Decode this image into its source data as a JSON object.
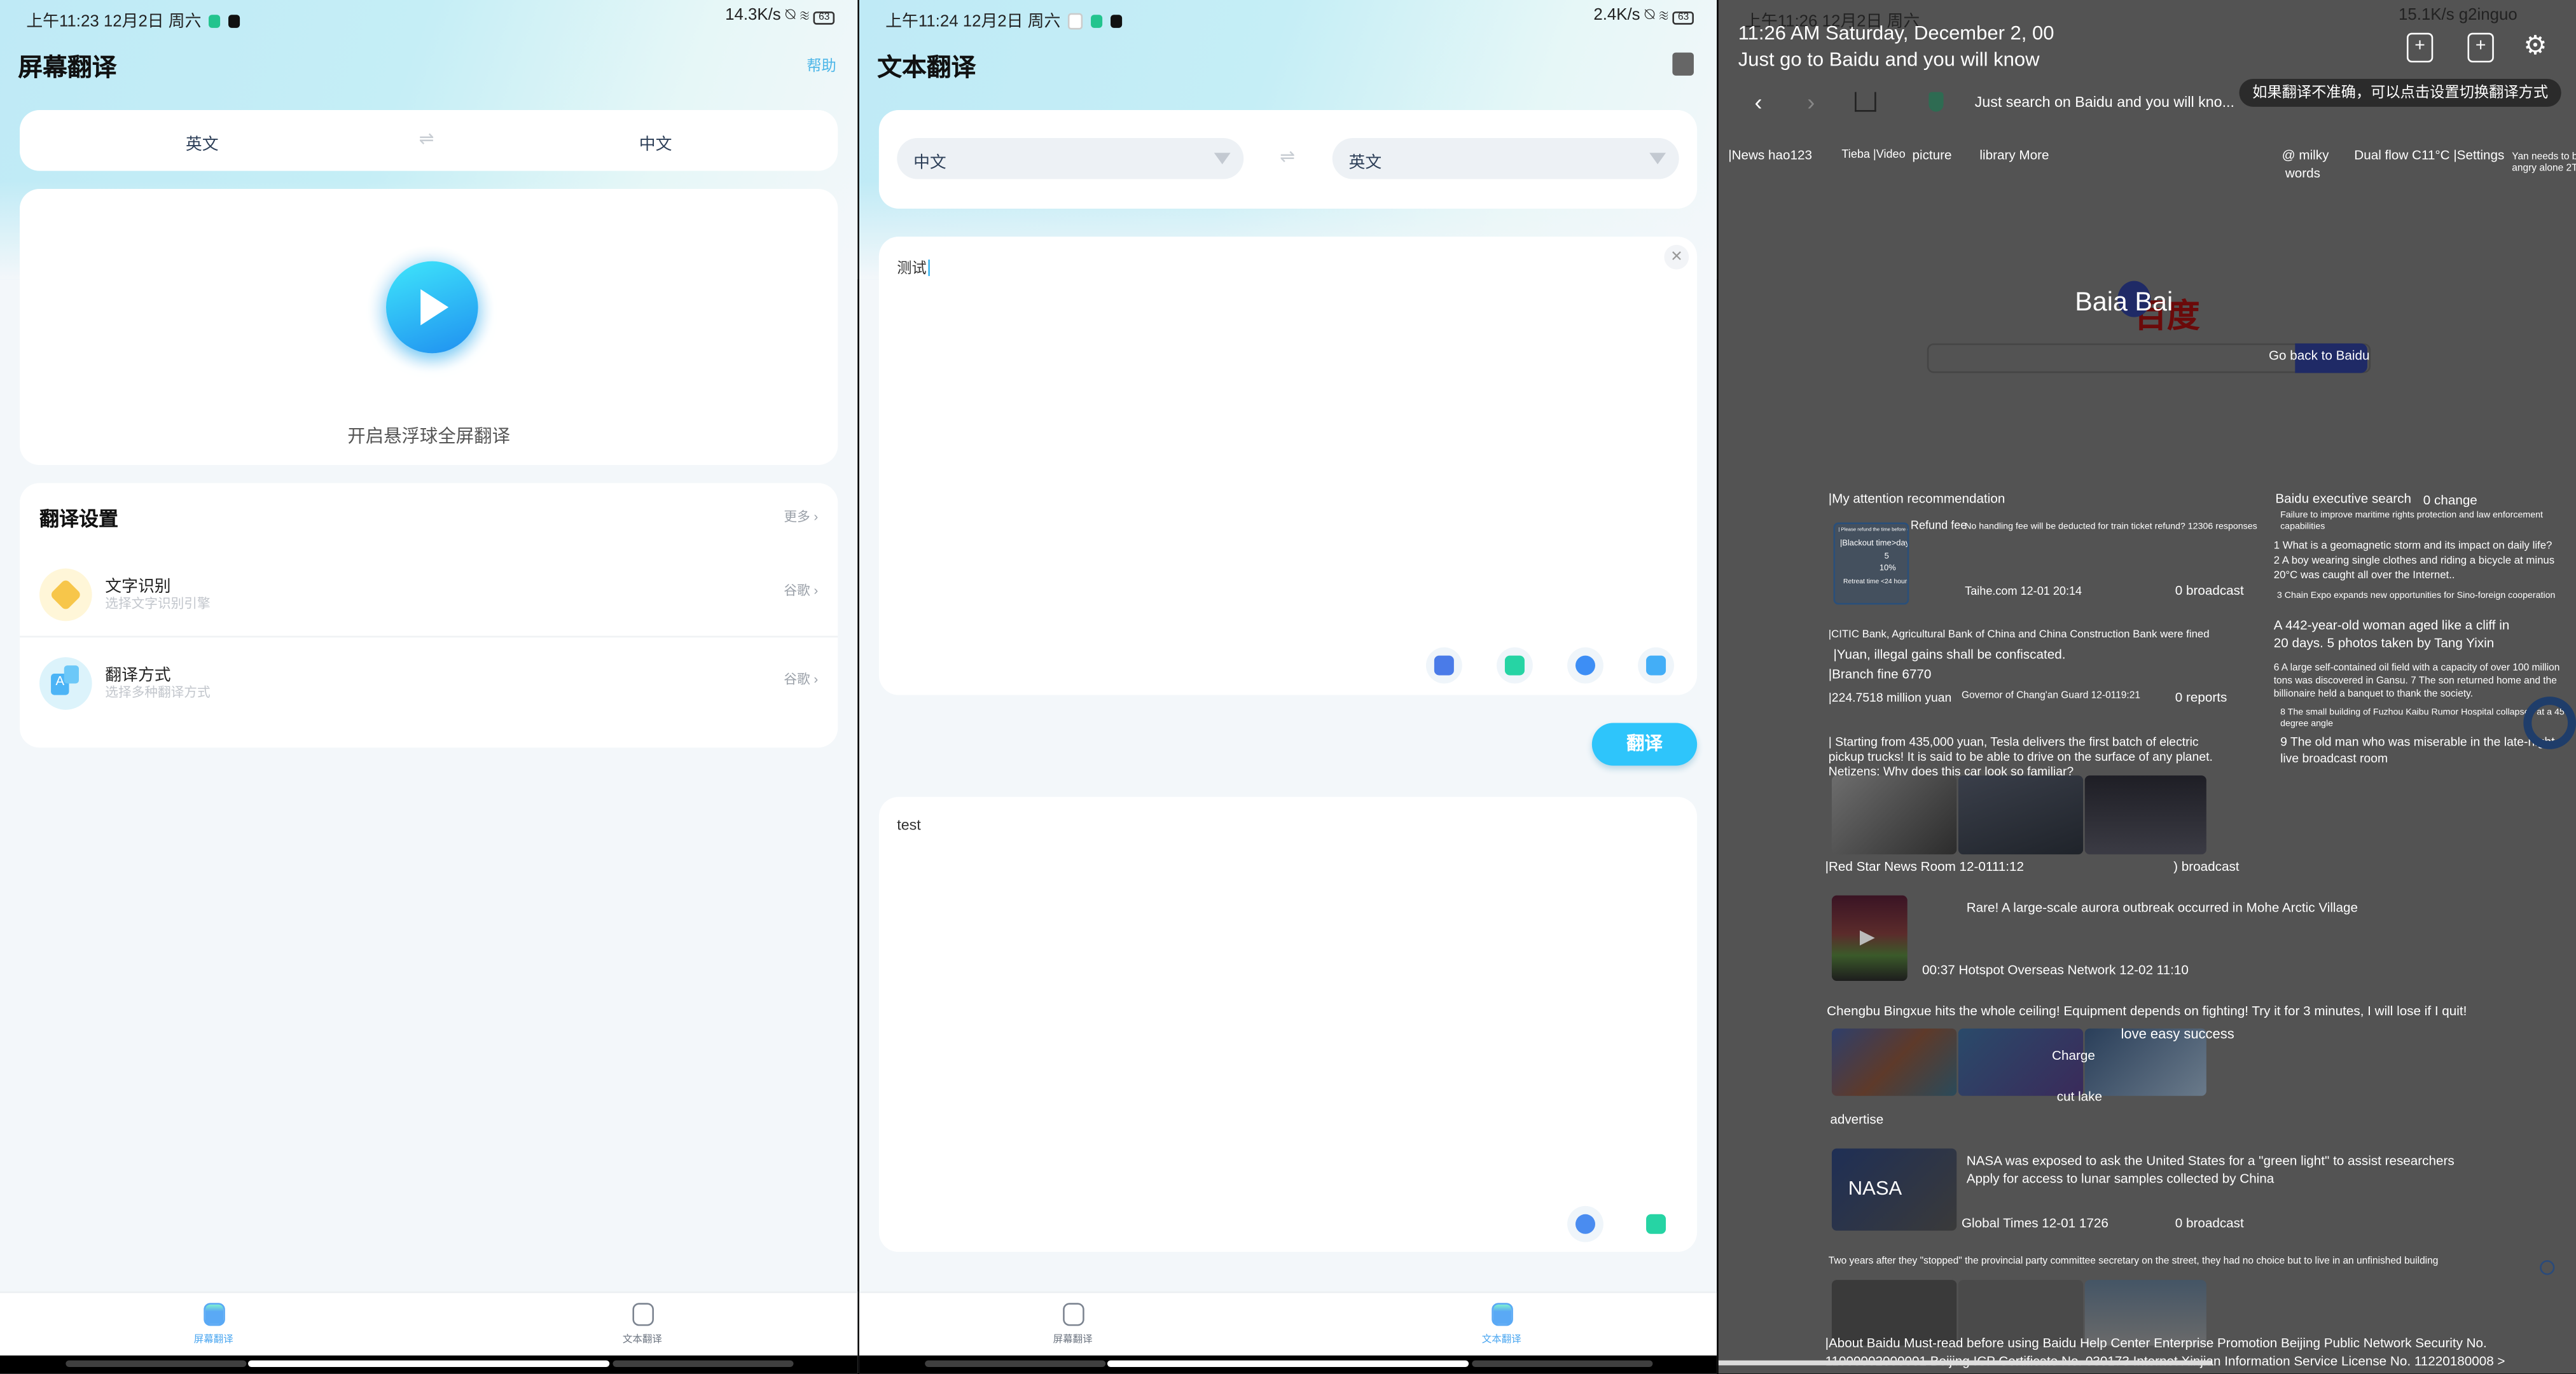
{
  "panel1": {
    "status": {
      "time": "上午11:23 12月2日 周六",
      "speed": "14.3K/s",
      "battery": "63"
    },
    "title": "屏幕翻译",
    "help_link": "帮助",
    "lang_from": "英文",
    "lang_to": "中文",
    "swap_icon": "swap-arrows-icon",
    "start_label": "开启悬浮球全屏翻译",
    "settings": {
      "title": "翻译设置",
      "more": "更多",
      "items": [
        {
          "title": "文字识别",
          "subtitle": "选择文字识别引擎",
          "value": "谷歌",
          "icon": "ocr-icon"
        },
        {
          "title": "翻译方式",
          "subtitle": "选择多种翻译方式",
          "value": "谷歌",
          "icon": "translate-icon"
        }
      ]
    },
    "nav": [
      {
        "label": "屏幕翻译",
        "active": true
      },
      {
        "label": "文本翻译",
        "active": false
      }
    ]
  },
  "panel2": {
    "status": {
      "time": "上午11:24 12月2日 周六",
      "speed": "2.4K/s",
      "battery": "63"
    },
    "title": "文本翻译",
    "source_lang": "中文",
    "target_lang": "英文",
    "input_value": "测试",
    "translate_button": "翻译",
    "output_value": "test",
    "tools": [
      "google-translate-icon",
      "text-compare-icon",
      "search-lens-icon",
      "camera-translate-icon"
    ],
    "output_tools": [
      "speaker-icon",
      "copy-text-icon"
    ],
    "nav": [
      {
        "label": "屏幕翻译",
        "active": false
      },
      {
        "label": "文本翻译",
        "active": true
      }
    ]
  },
  "panel3": {
    "status": {
      "time": "上午11:26 12月2日 周六",
      "right": "15.1K/s g2inguo"
    },
    "overlay_title": "11:26 AM Saturday, December 2, 00",
    "overlay_subtitle": "Just go to Baidu and you will know",
    "tooltip": "如果翻译不准确，可以点击设置切换翻译方式",
    "address": "Just search on Baidu and you will kno...",
    "links": {
      "news": "|News hao123",
      "tieba": "Tieba |Video",
      "picture": "picture",
      "more": "library More",
      "milky": "@ milky",
      "words": "words",
      "weather": "Dual flow C11°C |Settings",
      "user1": "Yan needs to be",
      "user2": "angry alone 2T"
    },
    "logo": "Baia Bai",
    "logo_cn": "百度",
    "search_button": "Go back to Baidu",
    "feed": {
      "section": "|My attention recommendation",
      "item1": {
        "thumb_label": "Refund fee",
        "title": "No handling fee will be deducted for train ticket refund? 12306 responses",
        "source": "Taihe.com 12-01 20:14",
        "count": "0 broadcast",
        "thumb_lines": [
          "| Please refund the time before departure",
          "|Blackout time>days",
          "5",
          "10%",
          "Retreat time <24 hours"
        ]
      },
      "item2": {
        "line1": "|CITIC Bank, Agricultural Bank of China and China Construction Bank were fined",
        "line2": "|Yuan, illegal gains shall be confiscated.",
        "line3": "|Branch fine 6770",
        "line4": "|224.7518 million yuan",
        "source": "Governor of Chang'an Guard 12-0119:21",
        "count": "0 reports"
      },
      "item3": {
        "line1": "| Starting from 435,000 yuan, Tesla delivers the first batch of electric",
        "line2": "pickup trucks! It is said to be able to drive on the surface of any planet.",
        "line3": "Netizens: Why does this car look so familiar?",
        "source": "|Red Star News Room 12-0111:12",
        "count": ") broadcast"
      },
      "item4": {
        "title": "Rare! A large-scale aurora outbreak occurred in Mohe Arctic Village",
        "meta": "00:37 Hotspot Overseas Network 12-02 11:10"
      },
      "item5": {
        "title": "Chengbu Bingxue hits the whole ceiling! Equipment depends on fighting! Try it for 3 minutes, I will lose if I quit!",
        "overlay1": "love easy success",
        "overlay2": "Charge",
        "overlay3": "cut lake",
        "tag": "advertise"
      },
      "item6": {
        "line1": "NASA was exposed to ask the United States for a \"green light\" to assist researchers",
        "line2": "Apply for access to lunar samples collected by China",
        "thumb_label": "NASA",
        "source": "Global Times 12-01 1726",
        "count": "0 broadcast"
      },
      "item7": {
        "title": "Two years after they \"stopped\" the provincial party committee secretary on the street, they had no choice but to live in an unfinished building"
      },
      "footer1": "|About Baidu Must-read before using Baidu Help Center Enterprise Promotion Beijing Public Network Security No.",
      "footer2": "11000002000001 Beijing ICP Certificate No. 030173 Internet Xinjian Information Service License No. 11220180008 >"
    },
    "hot": {
      "title": "Baidu executive search",
      "change": "0 change",
      "top1": "Failure to improve maritime rights protection and law enforcement",
      "top1b": "capabilities",
      "i1": "1 What is a geomagnetic storm and its impact on daily life?",
      "i2a": "2 A boy wearing single clothes and riding a bicycle at minus",
      "i2b": "20°C was caught all over the Internet..",
      "i3": "3 Chain Expo expands new opportunities for Sino-foreign cooperation",
      "i4a": "A 442-year-old woman aged like a cliff in",
      "i4b": "20 days. 5 photos taken by Tang Yixin",
      "i6a": "6 A large self-contained oil field with a capacity of over 100 million",
      "i6b": "tons was discovered in Gansu. 7 The son returned home and the",
      "i6c": "billionaire held a banquet to thank the society.",
      "i8a": "8 The small building of Fuzhou Kaibu Rumor Hospital collapsed at a 45",
      "i8b": "degree angle",
      "i9a": "9 The old man who was miserable in the late-night",
      "i9b": "live broadcast room"
    }
  },
  "colors": {
    "accent": "#2ec5fb",
    "link": "#4db6e8",
    "dark_bg": "#535353",
    "baidu_blue": "#1f2a66"
  }
}
